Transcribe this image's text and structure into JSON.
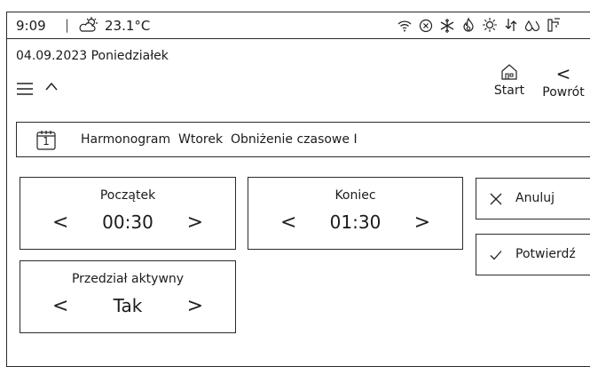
{
  "status": {
    "time": "9:09",
    "separator": "|",
    "temperature": "23.1°C",
    "icons": [
      "wifi-icon",
      "close-circle-icon",
      "snowflake-icon",
      "flame-icon",
      "sun-icon",
      "transfer-icon",
      "water-drops-icon",
      "faucet-icon"
    ]
  },
  "header": {
    "date": "04.09.2023 Poniedziałek",
    "start_label": "Start",
    "back_arrow": "<",
    "back_label": "Powrót"
  },
  "schedule": {
    "calendar_day": "1",
    "label": "Harmonogram  Wtorek  Obniżenie czasowe I"
  },
  "fields": {
    "start": {
      "title": "Początek",
      "value": "00:30"
    },
    "end": {
      "title": "Koniec",
      "value": "01:30"
    },
    "active": {
      "title": "Przedział aktywny",
      "value": "Tak"
    }
  },
  "arrows": {
    "left": "<",
    "right": ">"
  },
  "actions": {
    "cancel": "Anuluj",
    "confirm": "Potwierdź"
  }
}
